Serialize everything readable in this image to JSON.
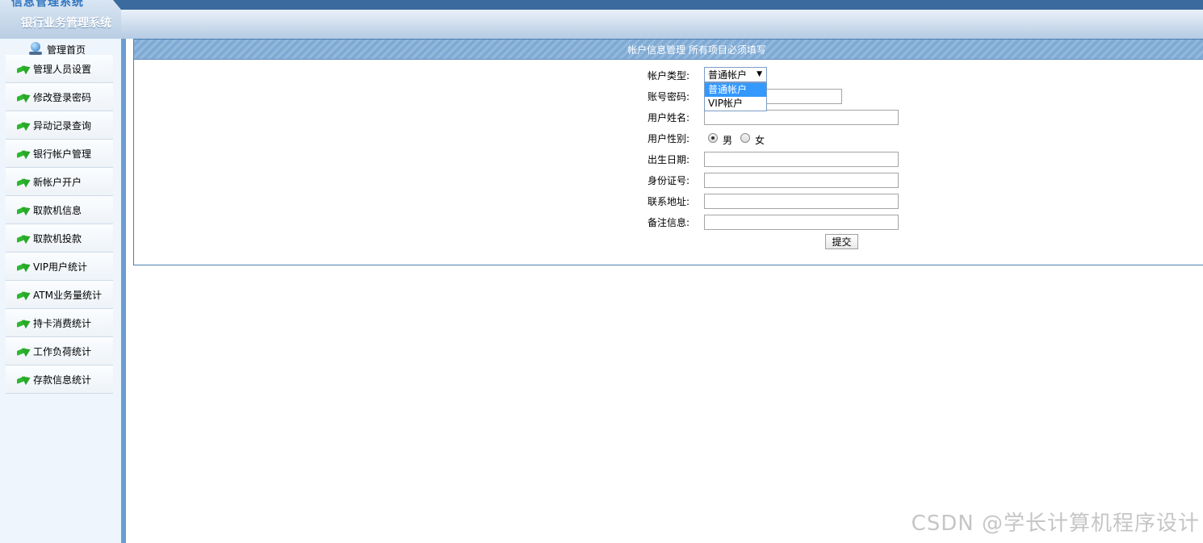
{
  "header": {
    "logo_text": "信息管理系统",
    "system_title": "银行业务管理系统"
  },
  "sidebar": {
    "home_label": "管理首页",
    "items": [
      {
        "label": "管理人员设置"
      },
      {
        "label": "修改登录密码"
      },
      {
        "label": "异动记录查询"
      },
      {
        "label": "银行帐户管理"
      },
      {
        "label": "新帐户开户"
      },
      {
        "label": "取款机信息"
      },
      {
        "label": "取款机投款"
      },
      {
        "label": "VIP用户统计"
      },
      {
        "label": "ATM业务量统计"
      },
      {
        "label": "持卡消费统计"
      },
      {
        "label": "工作负荷统计"
      },
      {
        "label": "存款信息统计"
      }
    ]
  },
  "panel": {
    "title": "帐户信息管理  所有项目必须填写"
  },
  "form": {
    "account_type_label": "帐户类型:",
    "account_type_value": "普通帐户",
    "account_type_options": [
      "普通帐户",
      "VIP帐户"
    ],
    "password_label": "账号密码:",
    "password_value": "",
    "name_label": "用户姓名:",
    "name_value": "",
    "gender_label": "用户性别:",
    "gender_male": "男",
    "gender_female": "女",
    "gender_selected": "男",
    "birthdate_label": "出生日期:",
    "birthdate_value": "",
    "id_label": "身份证号:",
    "id_value": "",
    "address_label": "联系地址:",
    "address_value": "",
    "note_label": "备注信息:",
    "note_value": "",
    "submit_label": "提交"
  },
  "watermark": "CSDN @学长计算机程序设计"
}
